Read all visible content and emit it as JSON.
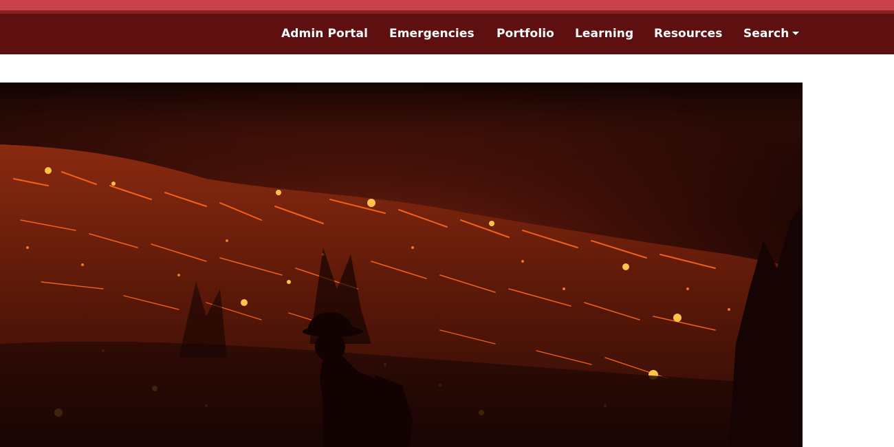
{
  "header": {
    "colors": {
      "top_accent": "#c9414b",
      "accent_line": "#8c1f21",
      "navbar_bg": "#5e1010",
      "nav_text": "#ffffff"
    },
    "nav_items": [
      {
        "label": "Admin Portal"
      },
      {
        "label": "Emergencies"
      },
      {
        "label": "Portfolio"
      },
      {
        "label": "Learning"
      },
      {
        "label": "Resources"
      },
      {
        "label": "Search",
        "has_dropdown": true,
        "dropdown_icon": "caret-down-icon"
      }
    ]
  },
  "hero": {
    "subject": "firefighter silhouette walking in front of burning hillside at night",
    "colors": {
      "sky": "#1a0604",
      "smoke": "#6a1e12",
      "fire": "#ff6a1c",
      "ember": "#ffc24a",
      "ground": "#230806"
    }
  }
}
